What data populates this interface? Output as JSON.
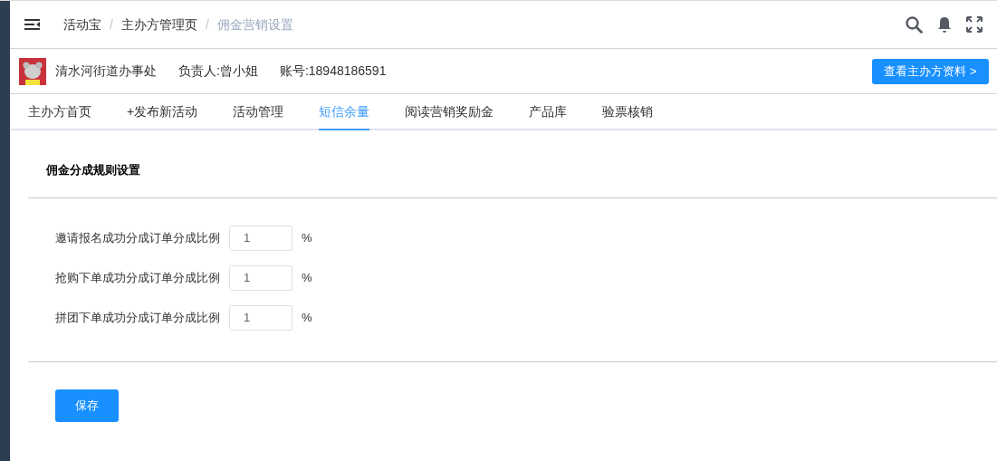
{
  "breadcrumb": [
    {
      "label": "活动宝",
      "current": false
    },
    {
      "separator": "/",
      "label": "主办方管理页",
      "current": false
    },
    {
      "separator": "/",
      "label": "佣金营销设置",
      "current": true
    }
  ],
  "organizer": {
    "name": "清水河街道办事处",
    "contact": "负责人:曾小姐",
    "account": "账号:18948186591",
    "button": "查看主办方资料 >"
  },
  "tabs": [
    {
      "label": "主办方首页",
      "selected": false
    },
    {
      "label": "+发布新活动",
      "selected": false
    },
    {
      "label": "活动管理",
      "selected": false
    },
    {
      "label": "短信余量",
      "selected": true
    },
    {
      "label": "阅读营销奖励金",
      "selected": false
    },
    {
      "label": "产品库",
      "selected": false
    },
    {
      "label": "验票核销",
      "selected": false
    }
  ],
  "section_title": "佣金分成规则设置",
  "fields": [
    {
      "label": "邀请报名成功分成订单分成比例",
      "value": "1",
      "unit": "%"
    },
    {
      "label": "抢购下单成功分成订单分成比例",
      "value": "1",
      "unit": "%"
    },
    {
      "label": "拼团下单成功分成订单分成比例",
      "value": "1",
      "unit": "%"
    }
  ],
  "save_button": "保存"
}
